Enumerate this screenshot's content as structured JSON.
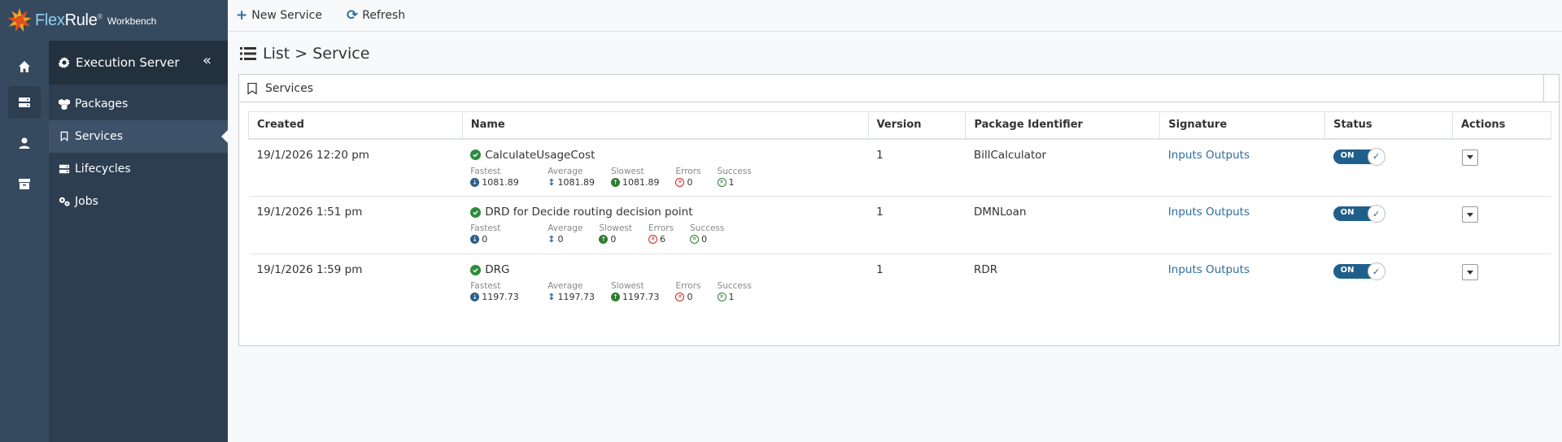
{
  "app": {
    "brand_a": "Flex",
    "brand_b": "Rule",
    "reg": "®",
    "product": "Workbench"
  },
  "rail": {
    "icons": [
      "home-icon",
      "server-icon",
      "user-icon",
      "archive-icon"
    ]
  },
  "nav": {
    "header": "Execution Server",
    "collapse": "«",
    "items": [
      {
        "label": "Packages",
        "icon": "packages-icon"
      },
      {
        "label": "Services",
        "icon": "bookmark-icon"
      },
      {
        "label": "Lifecycles",
        "icon": "lifecycles-icon"
      },
      {
        "label": "Jobs",
        "icon": "jobs-icon"
      }
    ]
  },
  "toolbar": {
    "new_label": "New Service",
    "refresh_label": "Refresh"
  },
  "page": {
    "title": "List > Service"
  },
  "card": {
    "title": "Services"
  },
  "table": {
    "headers": [
      "Created",
      "Name",
      "Version",
      "Package Identifier",
      "Signature",
      "Status",
      "Actions"
    ],
    "stat_labels": {
      "fastest": "Fastest",
      "average": "Average",
      "slowest": "Slowest",
      "errors": "Errors",
      "success": "Success"
    },
    "rows": [
      {
        "created": "19/1/2026 12:20 pm",
        "name": "CalculateUsageCost",
        "fastest": "1081.89",
        "average": "1081.89",
        "slowest": "1081.89",
        "errors": "0",
        "success": "1",
        "version": "1",
        "package": "BillCalculator",
        "signature": "Inputs Outputs",
        "status": "ON"
      },
      {
        "created": "19/1/2026 1:51 pm",
        "name": "DRD for Decide routing decision point",
        "fastest": "0",
        "average": "0",
        "slowest": "0",
        "errors": "6",
        "success": "0",
        "version": "1",
        "package": "DMNLoan",
        "signature": "Inputs Outputs",
        "status": "ON"
      },
      {
        "created": "19/1/2026 1:59 pm",
        "name": "DRG",
        "fastest": "1197.73",
        "average": "1197.73",
        "slowest": "1197.73",
        "errors": "0",
        "success": "1",
        "version": "1",
        "package": "RDR",
        "signature": "Inputs Outputs",
        "status": "ON"
      }
    ]
  },
  "colors": {
    "rail": "#354a5f",
    "nav": "#2c3e50",
    "accent": "#2c6ea0",
    "success": "#2e8b3e",
    "error": "#c62828"
  }
}
